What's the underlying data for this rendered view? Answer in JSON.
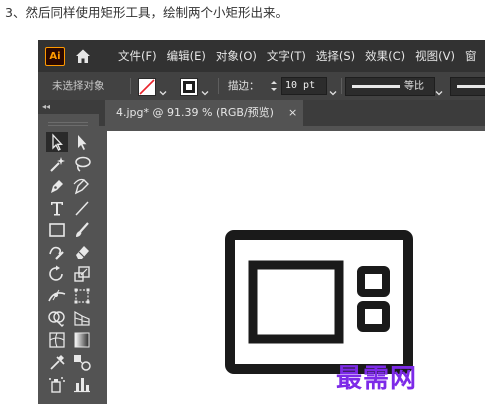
{
  "caption": "3、然后同样使用矩形工具，绘制两个小矩形出来。",
  "app": {
    "logo": "Ai",
    "home_icon": "home-icon",
    "menus": [
      "文件(F)",
      "编辑(E)",
      "对象(O)",
      "文字(T)",
      "选择(S)",
      "效果(C)",
      "视图(V)",
      "窗"
    ]
  },
  "control_bar": {
    "no_selection": "未选择对象",
    "stroke_label": "描边：",
    "stroke_value": "10 pt",
    "profile_label": "等比",
    "fill_swatch": "none",
    "stroke_swatch": "#000000"
  },
  "toolbar": {
    "collapse": "◂◂",
    "tools": [
      "selection-tool-icon",
      "direct-selection-tool-icon",
      "magic-wand-tool-icon",
      "lasso-tool-icon",
      "pen-tool-icon",
      "curvature-tool-icon",
      "type-tool-icon",
      "line-segment-tool-icon",
      "rectangle-tool-icon",
      "paintbrush-tool-icon",
      "shaper-tool-icon",
      "eraser-tool-icon",
      "rotate-tool-icon",
      "scale-tool-icon",
      "width-tool-icon",
      "free-transform-tool-icon",
      "shape-builder-tool-icon",
      "perspective-grid-tool-icon",
      "mesh-tool-icon",
      "gradient-tool-icon",
      "eyedropper-tool-icon",
      "blend-tool-icon",
      "symbol-sprayer-tool-icon",
      "column-graph-tool-icon"
    ]
  },
  "document": {
    "tab_title": "4.jpg* @ 91.39 % (RGB/预览)",
    "close": "×"
  },
  "watermark": "最需网",
  "colors": {
    "menubar": "#323232",
    "panel": "#535353",
    "logo_accent": "#ff9a00",
    "watermark": "#7d2ae8"
  }
}
